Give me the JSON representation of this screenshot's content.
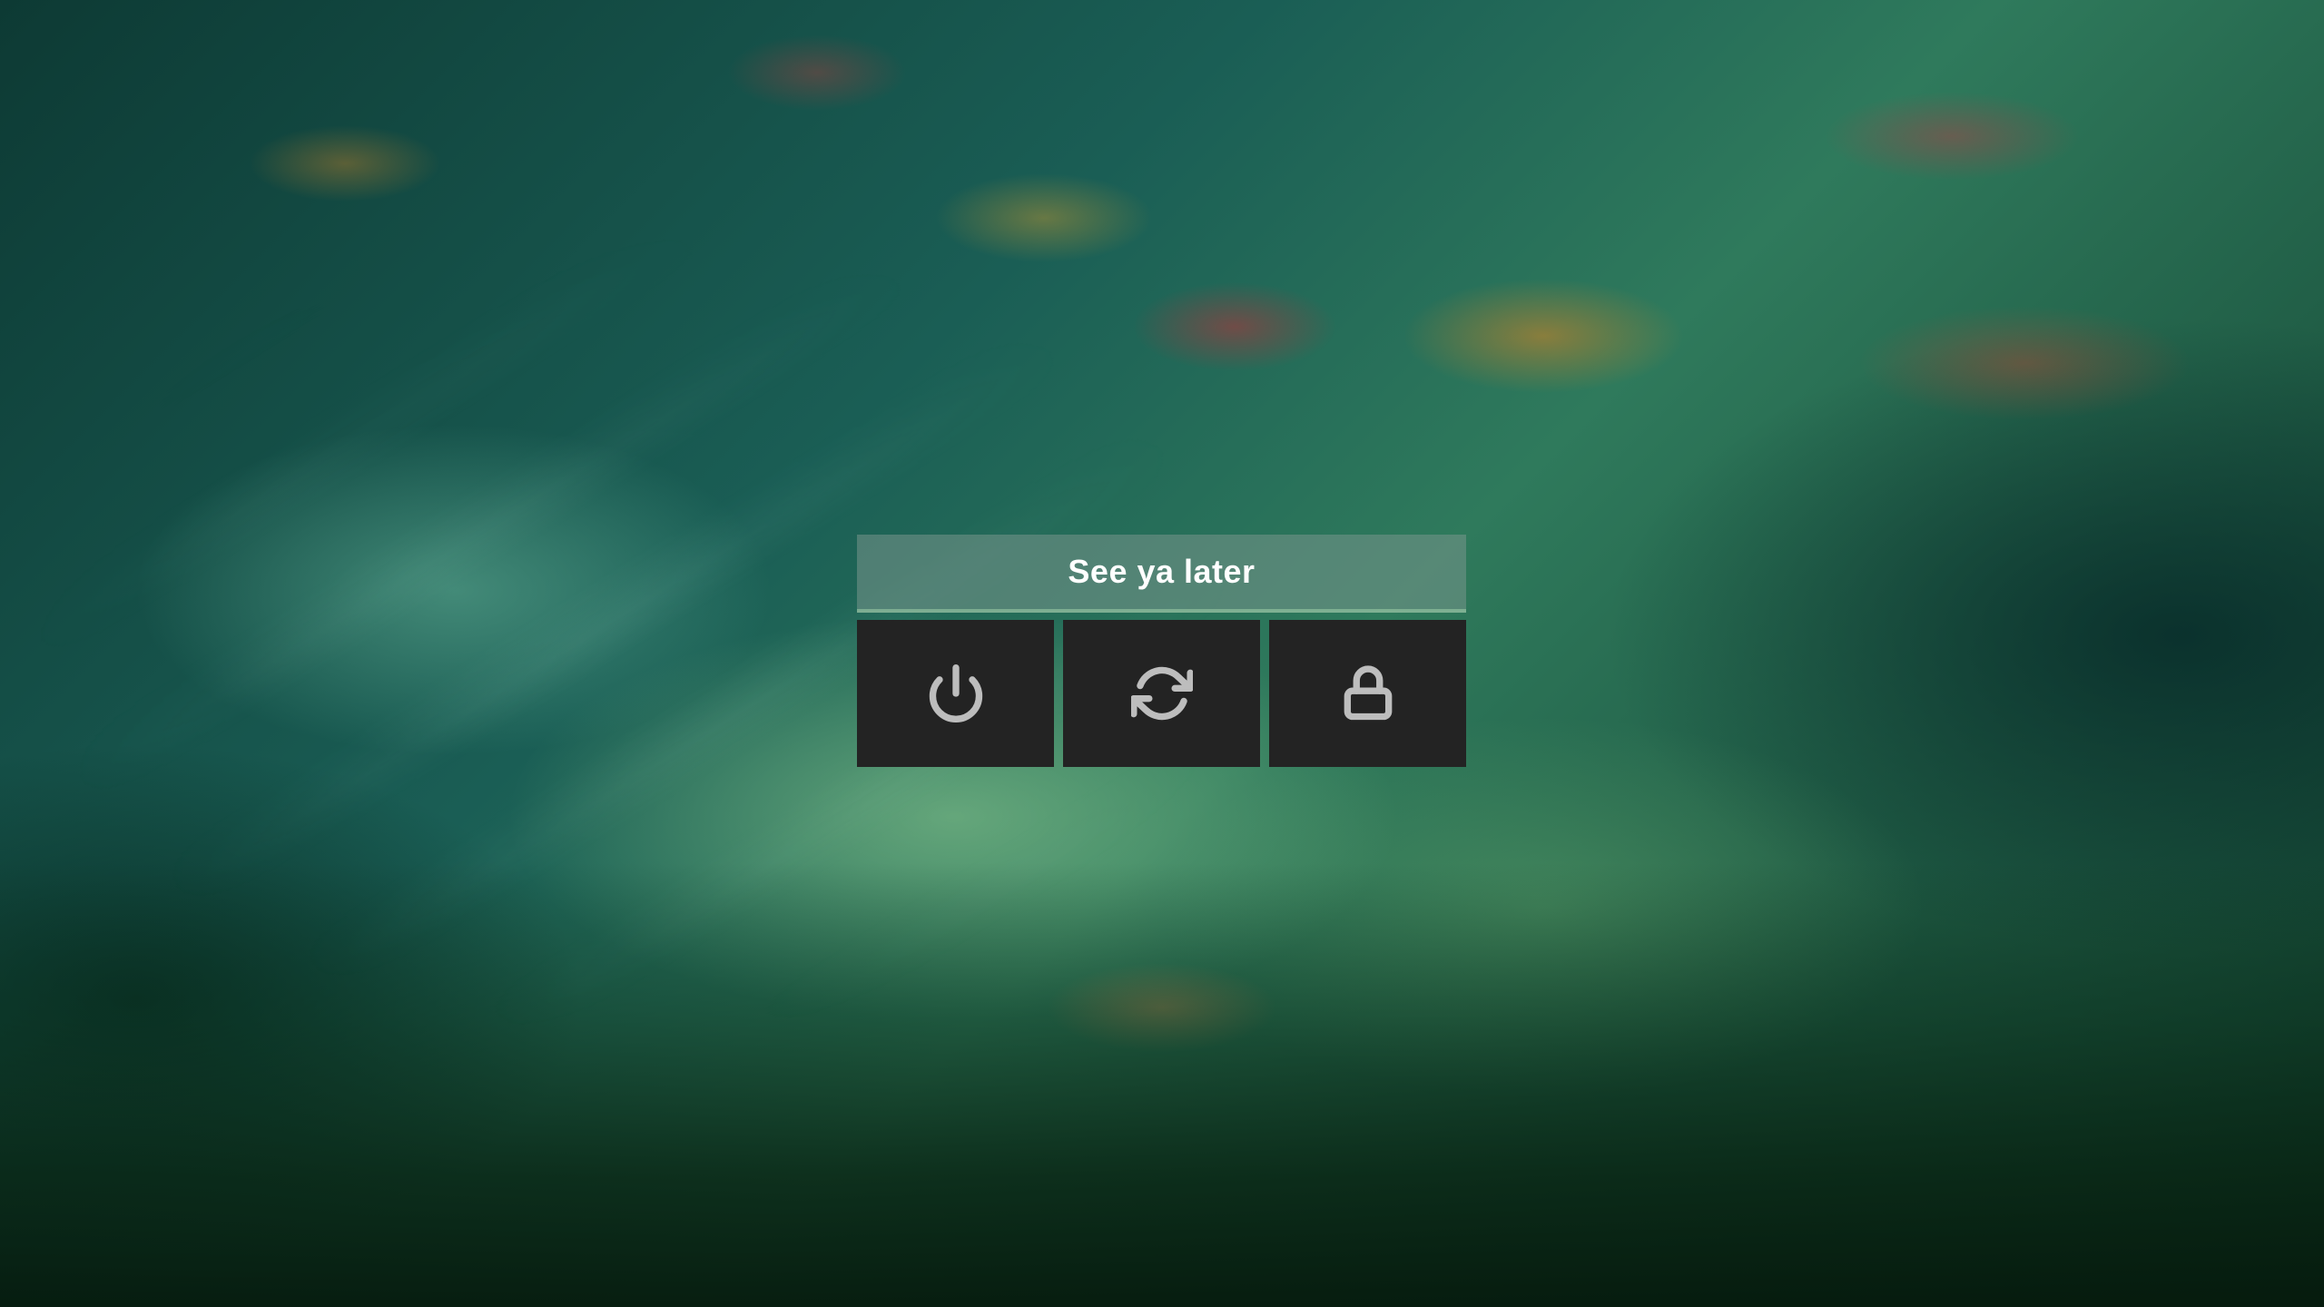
{
  "background": {
    "type": "forest-mist-wallpaper"
  },
  "session_menu": {
    "title": "See ya later",
    "buttons": [
      {
        "icon": "power-icon",
        "action": "shutdown"
      },
      {
        "icon": "restart-icon",
        "action": "reboot"
      },
      {
        "icon": "lock-icon",
        "action": "lock"
      }
    ],
    "colors": {
      "button_bg": "#232323",
      "icon": "#bdbdbd",
      "title": "#ffffff"
    }
  }
}
